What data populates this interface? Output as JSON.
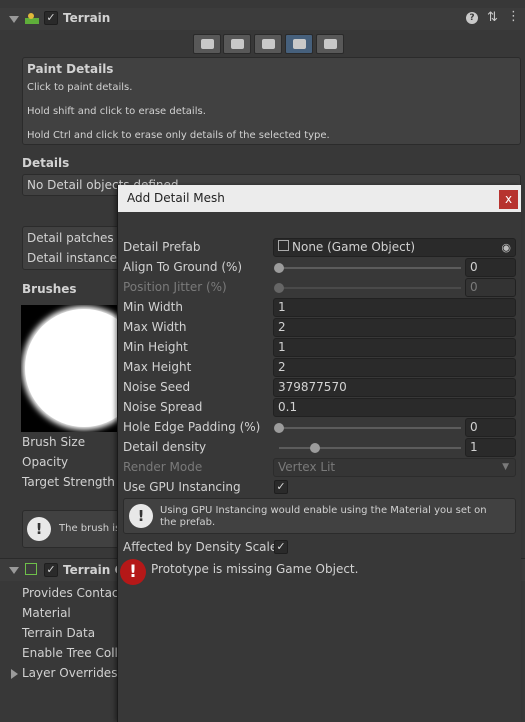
{
  "terrain_header": {
    "title": "Terrain",
    "checked": "✓"
  },
  "paint_details": {
    "title": "Paint Details",
    "lines": [
      "Click to paint details.",
      "Hold shift and click to erase details.",
      "Hold Ctrl and click to erase only details of the selected type."
    ]
  },
  "details": {
    "title": "Details",
    "empty_text": "No Detail objects defined"
  },
  "detail_info": {
    "patches": "Detail patches c",
    "instance": "Detail instance d"
  },
  "brushes": {
    "title": "Brushes",
    "size_label": "Brush Size",
    "opacity_label": "Opacity",
    "strength_label": "Target Strength",
    "help_text": "The brush is"
  },
  "collider_header": {
    "title": "Terrain C",
    "checked": "✓"
  },
  "collider_props": [
    "Provides Contact",
    "Material",
    "Terrain Data",
    "Enable Tree Colli",
    "Layer Overrides"
  ],
  "dialog": {
    "title": "Add Detail Mesh",
    "close": "x",
    "detail_prefab": {
      "label": "Detail Prefab",
      "value": "None (Game Object)"
    },
    "align_to_ground": {
      "label": "Align To Ground (%)",
      "value": "0",
      "level": 0
    },
    "position_jitter": {
      "label": "Position Jitter (%)",
      "value": "0",
      "level": 0
    },
    "min_width": {
      "label": "Min Width",
      "value": "1"
    },
    "max_width": {
      "label": "Max Width",
      "value": "2"
    },
    "min_height": {
      "label": "Min Height",
      "value": "1"
    },
    "max_height": {
      "label": "Max Height",
      "value": "2"
    },
    "noise_seed": {
      "label": "Noise Seed",
      "value": "379877570"
    },
    "noise_spread": {
      "label": "Noise Spread",
      "value": "0.1"
    },
    "hole_edge_padding": {
      "label": "Hole Edge Padding (%)",
      "value": "0",
      "level": 0
    },
    "detail_density": {
      "label": "Detail density",
      "value": "1",
      "level": 0.2
    },
    "render_mode": {
      "label": "Render Mode",
      "value": "Vertex Lit"
    },
    "use_gpu_instancing": {
      "label": "Use GPU Instancing",
      "checked": "✓"
    },
    "gpu_help": "Using GPU Instancing would enable using the Material you set on the prefab.",
    "affected_by_density": {
      "label": "Affected by Density Scale",
      "checked": "✓"
    },
    "error_text": "Prototype is missing Game Object."
  },
  "colors": {
    "accent": "#46607c",
    "error": "#b51818",
    "close_button": "#b7332f"
  }
}
